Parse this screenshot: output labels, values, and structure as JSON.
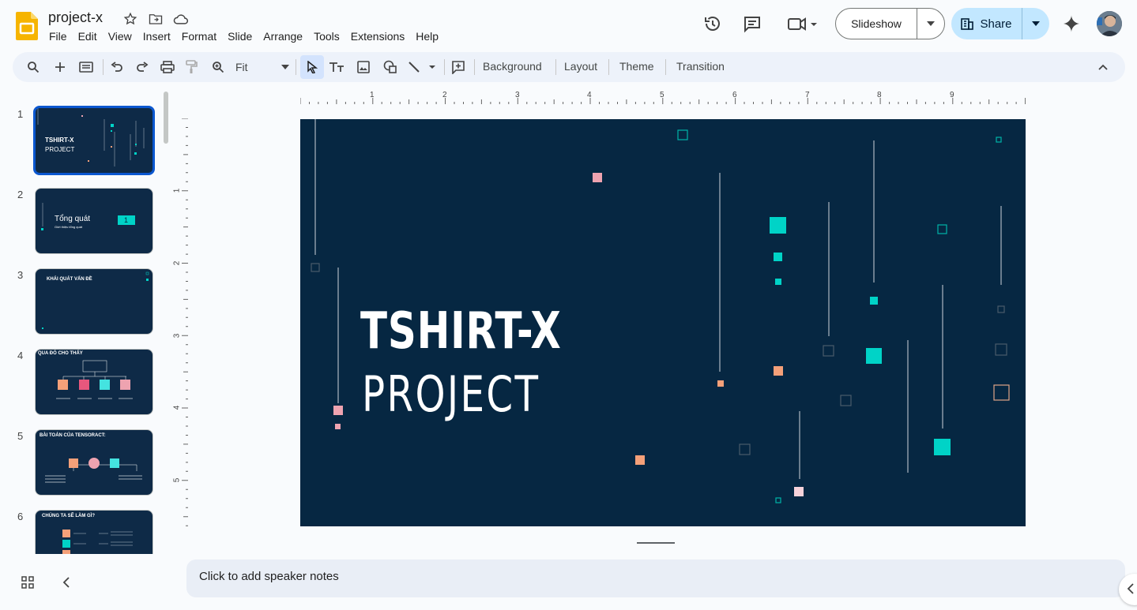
{
  "app": {
    "doc_title": "project-x",
    "menu": [
      "File",
      "Edit",
      "View",
      "Insert",
      "Format",
      "Slide",
      "Arrange",
      "Tools",
      "Extensions",
      "Help"
    ],
    "slideshow_label": "Slideshow",
    "share_label": "Share"
  },
  "toolbar": {
    "zoom_value": "Fit",
    "background_label": "Background",
    "layout_label": "Layout",
    "theme_label": "Theme",
    "transition_label": "Transition"
  },
  "rulers": {
    "top_numbers": [
      "1",
      "2",
      "3",
      "4",
      "5",
      "6",
      "7",
      "8",
      "9"
    ],
    "left_numbers": [
      "1",
      "2",
      "3",
      "4",
      "5"
    ]
  },
  "thumbnails": [
    {
      "num": "1",
      "title": "TSHIRT-X",
      "subtitle": "PROJECT"
    },
    {
      "num": "2",
      "title": "Tổng quát",
      "subtitle": "Giới thiệu tổng quát",
      "badge": "1"
    },
    {
      "num": "3",
      "title": "KHÁI QUÁT VẤN ĐỀ"
    },
    {
      "num": "4",
      "title": "QUA ĐÓ CHO THẤY"
    },
    {
      "num": "5",
      "title": "BÀI TOÁN CỦA TENSORACT:"
    },
    {
      "num": "6",
      "title": "CHÚNG TA SẼ LÀM GÌ?"
    }
  ],
  "slide": {
    "title": "TSHIRT-X",
    "subtitle": "PROJECT"
  },
  "notes_placeholder": "Click to add speaker notes",
  "colors": {
    "slide_bg": "#062742",
    "teal": "#00d3c7",
    "salmon": "#f4a079",
    "pink": "#eea3b0",
    "accent_blue": "#0b57d0",
    "share_bg": "#c2e7ff"
  }
}
